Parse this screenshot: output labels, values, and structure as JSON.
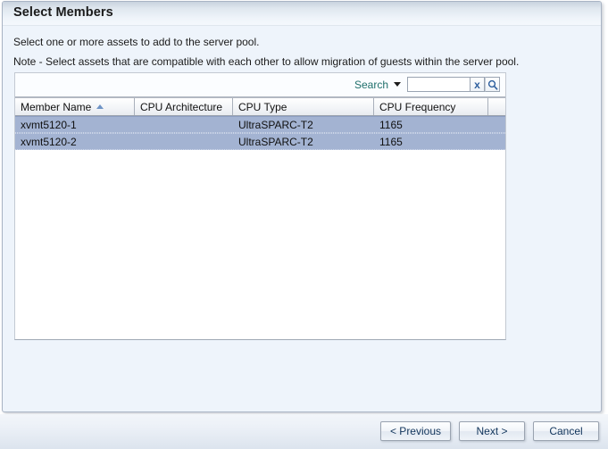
{
  "window": {
    "title": "Select Members"
  },
  "instructions": {
    "primary": "Select one or more assets to add to the server pool.",
    "note": "Note - Select assets that are compatible with each other to allow migration of guests within the server pool."
  },
  "search": {
    "label": "Search",
    "dropdown_icon": "chevron-down-icon",
    "value": "",
    "placeholder": "",
    "clear_icon": "x",
    "search_icon": "magnifier-icon"
  },
  "table": {
    "sort": {
      "column": "Member Name",
      "direction": "ascending",
      "icon": "sort-ascending-icon"
    },
    "columns": [
      "Member Name",
      "CPU Architecture",
      "CPU Type",
      "CPU Frequency"
    ],
    "rows": [
      {
        "selected": true,
        "cells": [
          "xvmt5120-1",
          "",
          "UltraSPARC-T2",
          "1165"
        ]
      },
      {
        "selected": true,
        "cells": [
          "xvmt5120-2",
          "",
          "UltraSPARC-T2",
          "1165"
        ]
      }
    ]
  },
  "buttons": {
    "previous": "< Previous",
    "next": "Next >",
    "cancel": "Cancel"
  },
  "colors": {
    "selection": "#a3b3d2",
    "panel_background": "#eef4fb",
    "search_link": "#1f6f6b",
    "sort_arrow": "#6f94c6",
    "button_text": "#12355c"
  }
}
